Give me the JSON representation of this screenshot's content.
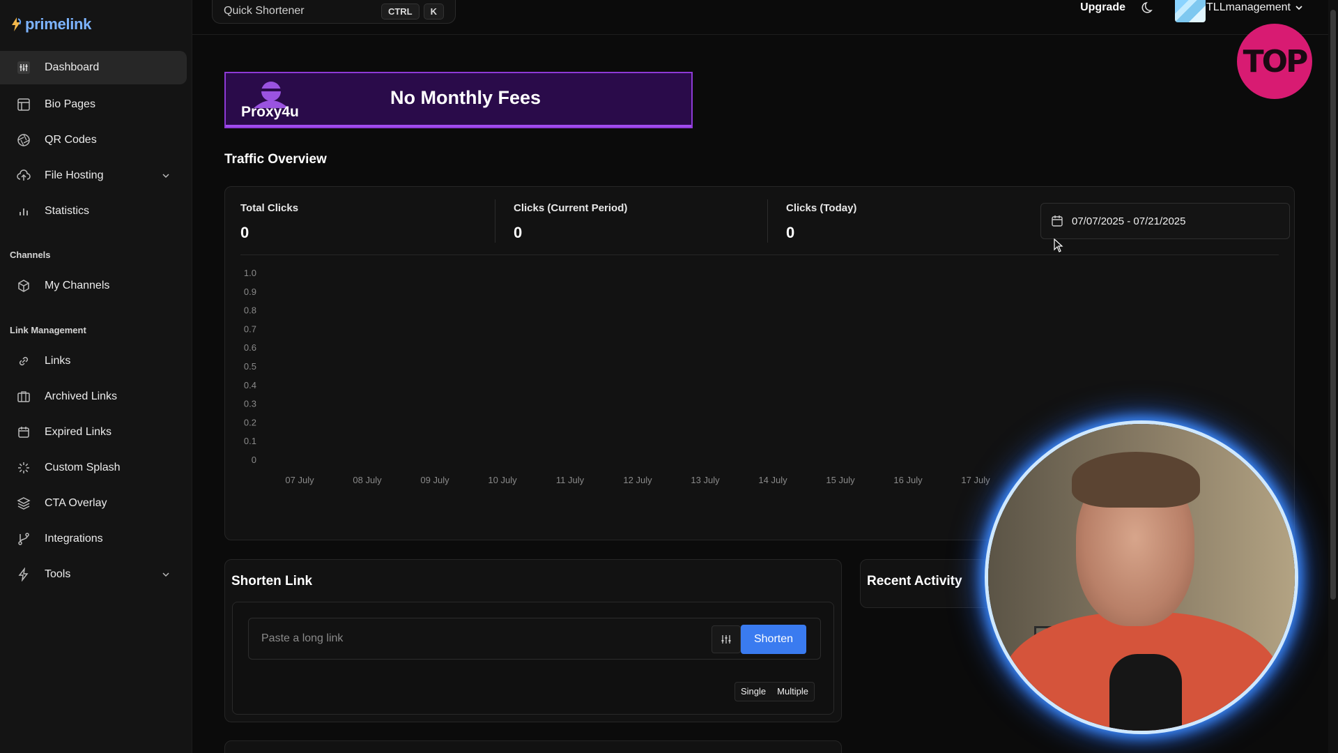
{
  "app": {
    "logo_text": "primelink"
  },
  "sidebar": {
    "items": [
      {
        "label": "Dashboard"
      },
      {
        "label": "Bio Pages"
      },
      {
        "label": "QR Codes"
      },
      {
        "label": "File Hosting"
      },
      {
        "label": "Statistics"
      },
      {
        "label": "My Channels"
      },
      {
        "label": "Links"
      },
      {
        "label": "Archived Links"
      },
      {
        "label": "Expired Links"
      },
      {
        "label": "Custom Splash"
      },
      {
        "label": "CTA Overlay"
      },
      {
        "label": "Integrations"
      },
      {
        "label": "Tools"
      }
    ],
    "sections": {
      "channels": "Channels",
      "link_management": "Link Management"
    }
  },
  "topbar": {
    "quick_shortener": "Quick Shortener",
    "kbd_ctrl": "CTRL",
    "kbd_k": "K",
    "upgrade": "Upgrade",
    "username": "TLLmanagement"
  },
  "badge": {
    "text": "TOP"
  },
  "banner": {
    "brand": "Proxy4u",
    "headline": "No Monthly Fees"
  },
  "traffic": {
    "title": "Traffic Overview",
    "stats": [
      {
        "label": "Total Clicks",
        "value": "0"
      },
      {
        "label": "Clicks (Current Period)",
        "value": "0"
      },
      {
        "label": "Clicks (Today)",
        "value": "0"
      }
    ],
    "date_range": "07/07/2025 - 07/21/2025"
  },
  "chart_data": {
    "type": "line",
    "categories": [
      "07 July",
      "08 July",
      "09 July",
      "10 July",
      "11 July",
      "12 July",
      "13 July",
      "14 July",
      "15 July",
      "16 July",
      "17 July"
    ],
    "y_ticks": [
      "1.0",
      "0.9",
      "0.8",
      "0.7",
      "0.6",
      "0.5",
      "0.4",
      "0.3",
      "0.2",
      "0.1",
      "0"
    ],
    "series": [
      {
        "values": [
          0,
          0,
          0,
          0,
          0,
          0,
          0,
          0,
          0,
          0,
          0
        ]
      }
    ],
    "ylim": [
      0,
      1
    ],
    "grid": false
  },
  "shorten": {
    "title": "Shorten Link",
    "placeholder": "Paste a long link",
    "button": "Shorten",
    "mode_single": "Single",
    "mode_multiple": "Multiple"
  },
  "recent": {
    "title": "Recent Activity"
  }
}
